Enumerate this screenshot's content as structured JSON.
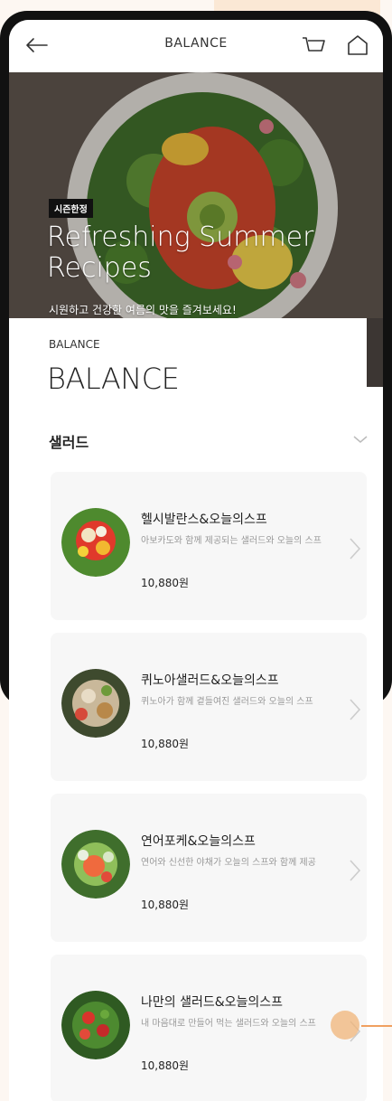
{
  "header": {
    "title": "BALANCE"
  },
  "hero": {
    "tag": "시즌한정",
    "title": "Refreshing Summer Recipes",
    "subtitle": "시원하고 건강한 여름의 맛을 즐겨보세요!"
  },
  "brand": {
    "small": "BALANCE",
    "big": "BALANCE"
  },
  "category": {
    "label": "샐러드"
  },
  "menu": [
    {
      "name": "헬시발란스&오늘의스프",
      "desc": "아보카도와 함께 제공되는 샐러드와 오늘의 스프",
      "price": "10,880원"
    },
    {
      "name": "퀴노아샐러드&오늘의스프",
      "desc": "퀴노아가 함께 곁들여진 샐러드와 오늘의 스프",
      "price": "10,880원"
    },
    {
      "name": "연어포케&오늘의스프",
      "desc": "연어와 신선한 야채가 오늘의 스프와 함께 제공",
      "price": "10,880원"
    },
    {
      "name": "나만의 샐러드&오늘의스프",
      "desc": "내 마음대로 만들어 먹는 샐러드와 오늘의 스프",
      "price": "10,880원"
    }
  ],
  "colors": {
    "accent": "#f0a060",
    "frame": "#111111",
    "card": "#f7f7f7"
  }
}
